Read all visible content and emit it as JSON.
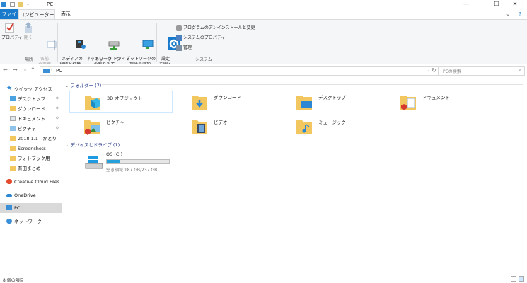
{
  "window": {
    "title": "PC",
    "buttons": {
      "minimize": "—",
      "maximize": "☐",
      "close": "✕"
    }
  },
  "ribbon_tabs": [
    "ファイル",
    "コンピューター",
    "表示"
  ],
  "ribbon_right": {
    "collapse": "⌄",
    "help": "?"
  },
  "ribbon": {
    "location_group": {
      "label": "場所",
      "buttons": [
        "プロパティ",
        "開く",
        "名前\nの変更"
      ]
    },
    "network_group": {
      "label": "ネットワーク",
      "buttons": [
        "メディアの\n接続と切断 ▾",
        "ネットワーク ドライブ\nの割り当て ▾",
        "ネットワークの\n場所の追加"
      ]
    },
    "system_group": {
      "label": "システム",
      "big_button": "設定\nを開く",
      "small_buttons": [
        "プログラムのアンインストールと変更",
        "システムのプロパティ",
        "管理"
      ]
    }
  },
  "address": {
    "path": "PC",
    "search_placeholder": "PCの検索"
  },
  "sidebar": {
    "quick_access": "クイック アクセス",
    "quick_items": [
      {
        "label": "デスクトップ",
        "pinned": true
      },
      {
        "label": "ダウンロード",
        "pinned": true
      },
      {
        "label": "ドキュメント",
        "pinned": true
      },
      {
        "label": "ピクチャ",
        "pinned": true
      },
      {
        "label": "2018.1.1　かとり",
        "pinned": false
      },
      {
        "label": "Screenshots",
        "pinned": false
      },
      {
        "label": "フォトブック用",
        "pinned": false
      },
      {
        "label": "有田まとめ",
        "pinned": false
      }
    ],
    "creative_cloud": "Creative Cloud Files",
    "onedrive": "OneDrive",
    "pc": "PC",
    "network": "ネットワーク"
  },
  "main": {
    "folders_header": "フォルダー (7)",
    "folders": [
      "3D オブジェクト",
      "ダウンロード",
      "デスクトップ",
      "ドキュメント",
      "ピクチャ",
      "ビデオ",
      "ミュージック"
    ],
    "drives_header": "デバイスとドライブ (1)",
    "drive": {
      "name": "OS (C:)",
      "free_text": "空き領域 187 GB/237 GB",
      "used_fraction": 0.21
    }
  },
  "status": {
    "items": "8 個の項目"
  },
  "colors": {
    "accent": "#1979ca",
    "folder": "#f3c760",
    "selection": "#d9d9d9"
  }
}
